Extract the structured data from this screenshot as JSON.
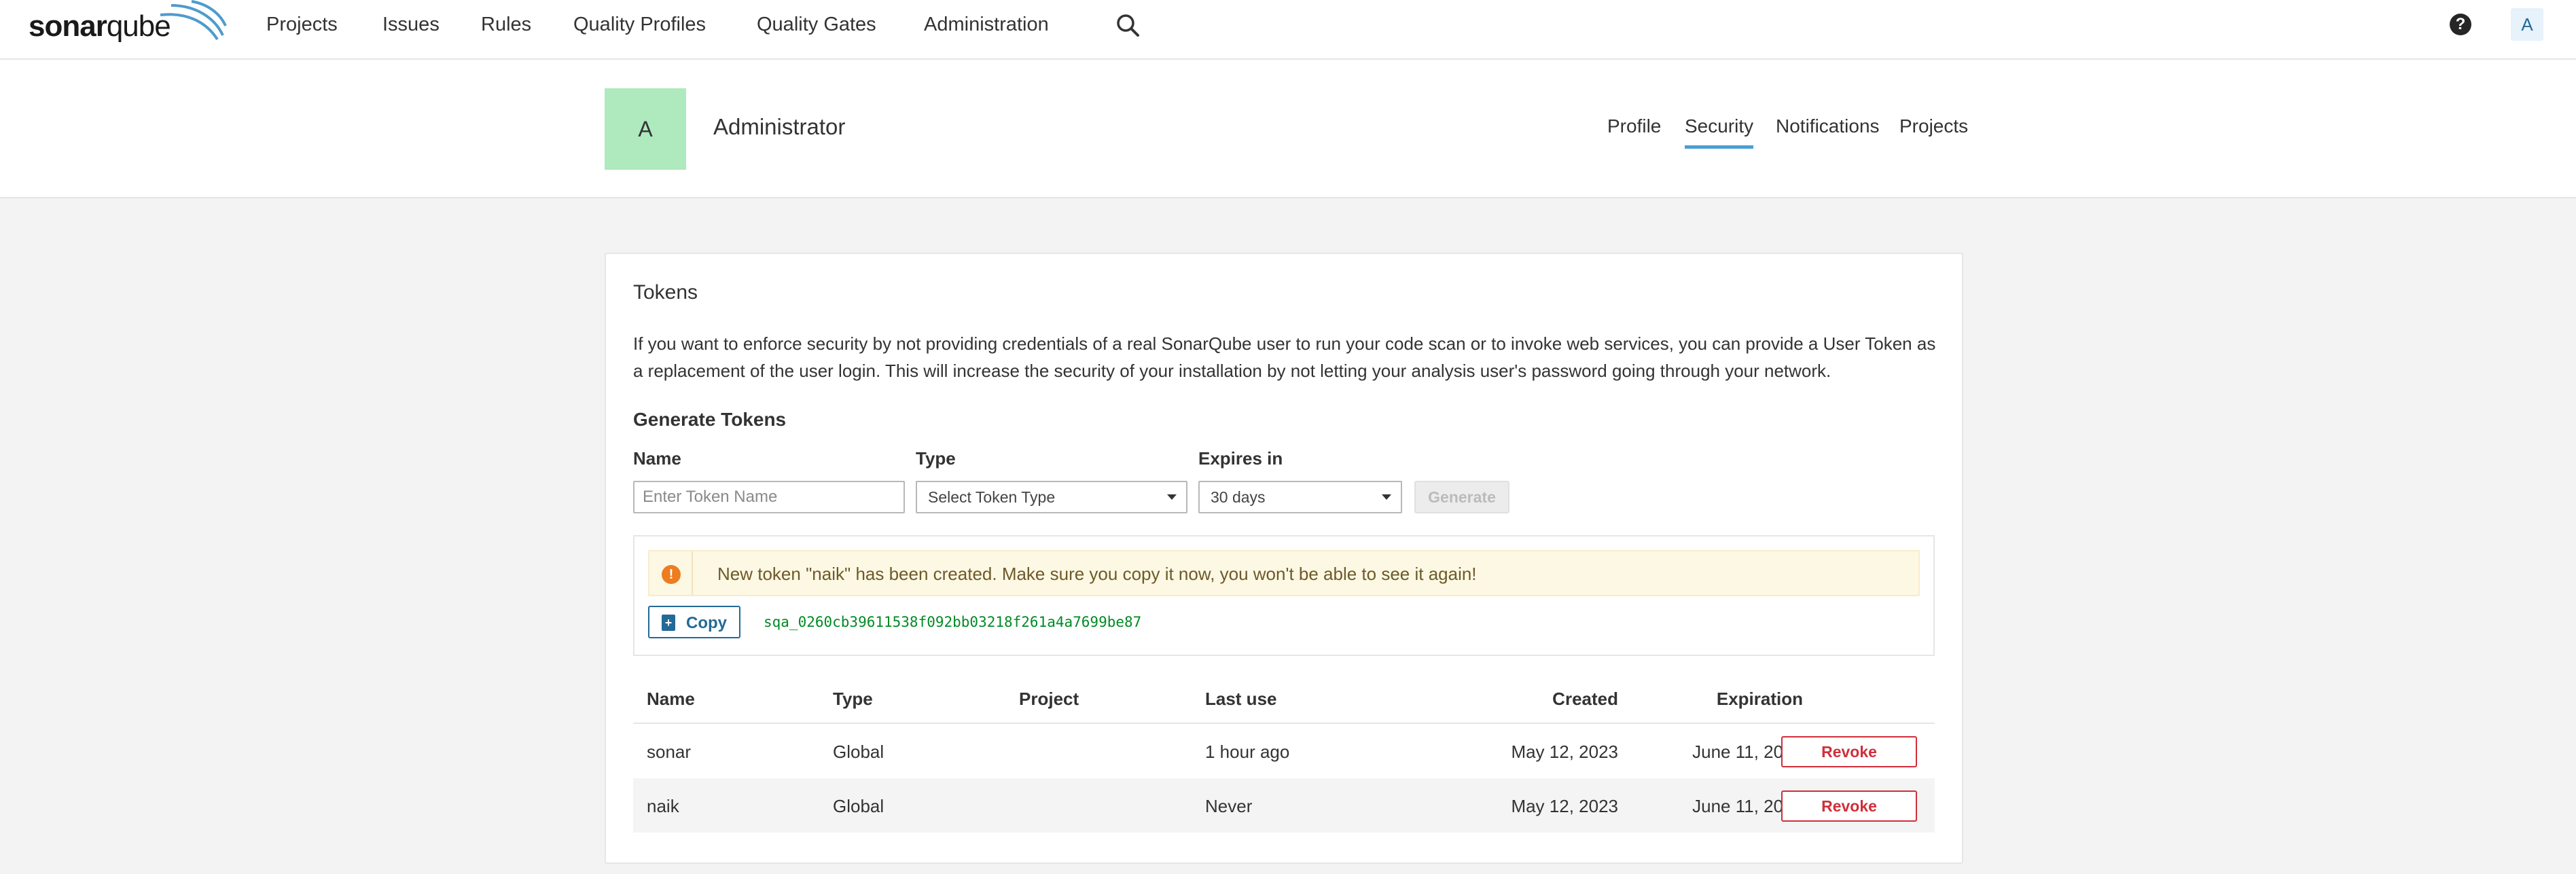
{
  "nav": {
    "logo_bold": "sonar",
    "logo_light": "qube",
    "items": [
      "Projects",
      "Issues",
      "Rules",
      "Quality Profiles",
      "Quality Gates",
      "Administration"
    ],
    "help_glyph": "?",
    "avatar_initial": "A"
  },
  "header": {
    "avatar_initial": "A",
    "avatar_color": "#aeeabe",
    "user_name": "Administrator",
    "tabs": [
      "Profile",
      "Security",
      "Notifications",
      "Projects"
    ],
    "active_tab": "Security"
  },
  "tokens": {
    "title": "Tokens",
    "intro": "If you want to enforce security by not providing credentials of a real SonarQube user to run your code scan or to invoke web services, you can provide a User Token as a replacement of the user login. This will increase the security of your installation by not letting your analysis user's password going through your network.",
    "generate_title": "Generate Tokens",
    "name_label": "Name",
    "name_placeholder": "Enter Token Name",
    "type_label": "Type",
    "type_value": "Select Token Type",
    "expires_label": "Expires in",
    "expires_value": "30 days",
    "generate_button": "Generate",
    "alert_icon": "!",
    "alert_text": "New token \"naik\" has been created. Make sure you copy it now, you won't be able to see it again!",
    "copy_button": "Copy",
    "token_value": "sqa_0260cb39611538f092bb03218f261a4a7699be87",
    "columns": [
      "Name",
      "Type",
      "Project",
      "Last use",
      "Created",
      "Expiration"
    ],
    "rows": [
      {
        "name": "sonar",
        "type": "Global",
        "project": "",
        "last_use": "1 hour ago",
        "created": "May 12, 2023",
        "expiration": "June 11, 2023",
        "action": "Revoke"
      },
      {
        "name": "naik",
        "type": "Global",
        "project": "",
        "last_use": "Never",
        "created": "May 12, 2023",
        "expiration": "June 11, 2023",
        "action": "Revoke"
      }
    ]
  },
  "colors": {
    "accent": "#4b9fd5",
    "link": "#236a97",
    "danger": "#d02f3a",
    "token_green": "#008a25",
    "warning": "#ed7d20"
  }
}
